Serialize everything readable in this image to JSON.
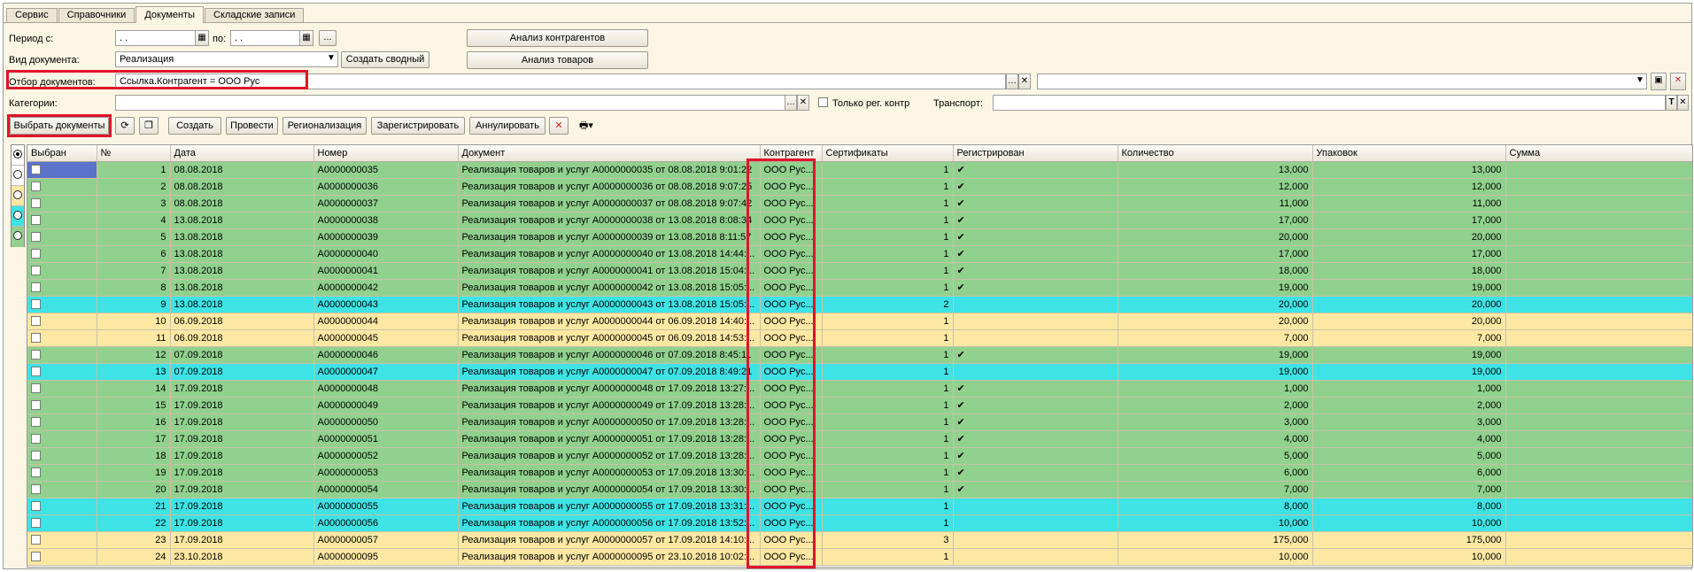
{
  "tabs": [
    "Сервис",
    "Справочники",
    "Документы",
    "Складские записи"
  ],
  "active_tab": 2,
  "filters": {
    "period_label": "Период с:",
    "period_from": " .  . ",
    "period_to_label": "по:",
    "period_to": " .  . ",
    "more_button": "...",
    "doctype_label": "Вид документа:",
    "doctype_value": "Реализация",
    "create_summary": "Создать сводный",
    "analysis_contractors": "Анализ контрагентов",
    "analysis_goods": "Анализ товаров",
    "selection_label": "Отбор документов:",
    "selection_value": "Ссылка.Контрагент =  ООО Рус",
    "categories_label": "Категории:",
    "categories_value": "",
    "only_reg_label": "Только рег. контр",
    "transport_label": "Транспорт:",
    "transport_value": ""
  },
  "toolbar": {
    "select_docs": "Выбрать документы",
    "create": "Создать",
    "post": "Провести",
    "regionalize": "Регионализация",
    "register": "Зарегистрировать",
    "annul": "Аннулировать"
  },
  "columns": [
    "Выбран",
    "№",
    "Дата",
    "Номер",
    "Документ",
    "Контрагент",
    "Сертификаты",
    "Регистрирован",
    "Количество",
    "Упаковок",
    "Сумма"
  ],
  "rows": [
    {
      "n": "1",
      "date": "08.08.2018",
      "num": "А0000000035",
      "doc": "Реализация товаров и услуг А0000000035 от 08.08.2018 9:01:22",
      "ctr": "ООО Рус...",
      "cert": "1",
      "reg": "✔",
      "qty": "13,000",
      "pack": "13,000",
      "sum": "",
      "color": "green"
    },
    {
      "n": "2",
      "date": "08.08.2018",
      "num": "А0000000036",
      "doc": "Реализация товаров и услуг А0000000036 от 08.08.2018 9:07:25",
      "ctr": "ООО Рус...",
      "cert": "1",
      "reg": "✔",
      "qty": "12,000",
      "pack": "12,000",
      "sum": "",
      "color": "green"
    },
    {
      "n": "3",
      "date": "08.08.2018",
      "num": "А0000000037",
      "doc": "Реализация товаров и услуг А0000000037 от 08.08.2018 9:07:42",
      "ctr": "ООО Рус...",
      "cert": "1",
      "reg": "✔",
      "qty": "11,000",
      "pack": "11,000",
      "sum": "",
      "color": "green"
    },
    {
      "n": "4",
      "date": "13.08.2018",
      "num": "А0000000038",
      "doc": "Реализация товаров и услуг А0000000038 от 13.08.2018 8:08:34",
      "ctr": "ООО Рус...",
      "cert": "1",
      "reg": "✔",
      "qty": "17,000",
      "pack": "17,000",
      "sum": "",
      "color": "green"
    },
    {
      "n": "5",
      "date": "13.08.2018",
      "num": "А0000000039",
      "doc": "Реализация товаров и услуг А0000000039 от 13.08.2018 8:11:57",
      "ctr": "ООО Рус...",
      "cert": "1",
      "reg": "✔",
      "qty": "20,000",
      "pack": "20,000",
      "sum": "",
      "color": "green"
    },
    {
      "n": "6",
      "date": "13.08.2018",
      "num": "А0000000040",
      "doc": "Реализация товаров и услуг А0000000040 от 13.08.2018 14:44:...",
      "ctr": "ООО Рус...",
      "cert": "1",
      "reg": "✔",
      "qty": "17,000",
      "pack": "17,000",
      "sum": "",
      "color": "green"
    },
    {
      "n": "7",
      "date": "13.08.2018",
      "num": "А0000000041",
      "doc": "Реализация товаров и услуг А0000000041 от 13.08.2018 15:04:...",
      "ctr": "ООО Рус...",
      "cert": "1",
      "reg": "✔",
      "qty": "18,000",
      "pack": "18,000",
      "sum": "",
      "color": "green"
    },
    {
      "n": "8",
      "date": "13.08.2018",
      "num": "А0000000042",
      "doc": "Реализация товаров и услуг А0000000042 от 13.08.2018 15:05:...",
      "ctr": "ООО Рус...",
      "cert": "1",
      "reg": "✔",
      "qty": "19,000",
      "pack": "19,000",
      "sum": "",
      "color": "green"
    },
    {
      "n": "9",
      "date": "13.08.2018",
      "num": "А0000000043",
      "doc": "Реализация товаров и услуг А0000000043 от 13.08.2018 15:05:...",
      "ctr": "ООО Рус...",
      "cert": "2",
      "reg": "",
      "qty": "20,000",
      "pack": "20,000",
      "sum": "",
      "color": "cyan"
    },
    {
      "n": "10",
      "date": "06.09.2018",
      "num": "А0000000044",
      "doc": "Реализация товаров и услуг А0000000044 от 06.09.2018 14:40:...",
      "ctr": "ООО Рус...",
      "cert": "1",
      "reg": "",
      "qty": "20,000",
      "pack": "20,000",
      "sum": "",
      "color": "yellow"
    },
    {
      "n": "11",
      "date": "06.09.2018",
      "num": "А0000000045",
      "doc": "Реализация товаров и услуг А0000000045 от 06.09.2018 14:53:...",
      "ctr": "ООО Рус...",
      "cert": "1",
      "reg": "",
      "qty": "7,000",
      "pack": "7,000",
      "sum": "",
      "color": "yellow"
    },
    {
      "n": "12",
      "date": "07.09.2018",
      "num": "А0000000046",
      "doc": "Реализация товаров и услуг А0000000046 от 07.09.2018 8:45:11",
      "ctr": "ООО Рус...",
      "cert": "1",
      "reg": "✔",
      "qty": "19,000",
      "pack": "19,000",
      "sum": "",
      "color": "green"
    },
    {
      "n": "13",
      "date": "07.09.2018",
      "num": "А0000000047",
      "doc": "Реализация товаров и услуг А0000000047 от 07.09.2018 8:49:21",
      "ctr": "ООО Рус...",
      "cert": "1",
      "reg": "",
      "qty": "19,000",
      "pack": "19,000",
      "sum": "",
      "color": "cyan"
    },
    {
      "n": "14",
      "date": "17.09.2018",
      "num": "А0000000048",
      "doc": "Реализация товаров и услуг А0000000048 от 17.09.2018 13:27:...",
      "ctr": "ООО Рус...",
      "cert": "1",
      "reg": "✔",
      "qty": "1,000",
      "pack": "1,000",
      "sum": "",
      "color": "green"
    },
    {
      "n": "15",
      "date": "17.09.2018",
      "num": "А0000000049",
      "doc": "Реализация товаров и услуг А0000000049 от 17.09.2018 13:28:...",
      "ctr": "ООО Рус...",
      "cert": "1",
      "reg": "✔",
      "qty": "2,000",
      "pack": "2,000",
      "sum": "",
      "color": "green"
    },
    {
      "n": "16",
      "date": "17.09.2018",
      "num": "А0000000050",
      "doc": "Реализация товаров и услуг А0000000050 от 17.09.2018 13:28:...",
      "ctr": "ООО Рус...",
      "cert": "1",
      "reg": "✔",
      "qty": "3,000",
      "pack": "3,000",
      "sum": "",
      "color": "green"
    },
    {
      "n": "17",
      "date": "17.09.2018",
      "num": "А0000000051",
      "doc": "Реализация товаров и услуг А0000000051 от 17.09.2018 13:28:...",
      "ctr": "ООО Рус...",
      "cert": "1",
      "reg": "✔",
      "qty": "4,000",
      "pack": "4,000",
      "sum": "",
      "color": "green"
    },
    {
      "n": "18",
      "date": "17.09.2018",
      "num": "А0000000052",
      "doc": "Реализация товаров и услуг А0000000052 от 17.09.2018 13:28:...",
      "ctr": "ООО Рус...",
      "cert": "1",
      "reg": "✔",
      "qty": "5,000",
      "pack": "5,000",
      "sum": "",
      "color": "green"
    },
    {
      "n": "19",
      "date": "17.09.2018",
      "num": "А0000000053",
      "doc": "Реализация товаров и услуг А0000000053 от 17.09.2018 13:30:...",
      "ctr": "ООО Рус...",
      "cert": "1",
      "reg": "✔",
      "qty": "6,000",
      "pack": "6,000",
      "sum": "",
      "color": "green"
    },
    {
      "n": "20",
      "date": "17.09.2018",
      "num": "А0000000054",
      "doc": "Реализация товаров и услуг А0000000054 от 17.09.2018 13:30:...",
      "ctr": "ООО Рус...",
      "cert": "1",
      "reg": "✔",
      "qty": "7,000",
      "pack": "7,000",
      "sum": "",
      "color": "green"
    },
    {
      "n": "21",
      "date": "17.09.2018",
      "num": "А0000000055",
      "doc": "Реализация товаров и услуг А0000000055 от 17.09.2018 13:31:...",
      "ctr": "ООО Рус...",
      "cert": "1",
      "reg": "",
      "qty": "8,000",
      "pack": "8,000",
      "sum": "",
      "color": "cyan"
    },
    {
      "n": "22",
      "date": "17.09.2018",
      "num": "А0000000056",
      "doc": "Реализация товаров и услуг А0000000056 от 17.09.2018 13:52:...",
      "ctr": "ООО Рус...",
      "cert": "1",
      "reg": "",
      "qty": "10,000",
      "pack": "10,000",
      "sum": "",
      "color": "cyan"
    },
    {
      "n": "23",
      "date": "17.09.2018",
      "num": "А0000000057",
      "doc": "Реализация товаров и услуг А0000000057 от 17.09.2018 14:10:...",
      "ctr": "ООО Рус...",
      "cert": "3",
      "reg": "",
      "qty": "175,000",
      "pack": "175,000",
      "sum": "",
      "color": "yellow"
    },
    {
      "n": "24",
      "date": "23.10.2018",
      "num": "А0000000095",
      "doc": "Реализация товаров и услуг А0000000095 от 23.10.2018 10:02:...",
      "ctr": "ООО Рус...",
      "cert": "1",
      "reg": "",
      "qty": "10,000",
      "pack": "10,000",
      "sum": "",
      "color": "yellow"
    }
  ],
  "legend_colors": [
    "#ffffff",
    "#fde8a3",
    "#3ee3e5",
    "#91d18e"
  ],
  "colors": {
    "green": "#91d18e",
    "cyan": "#3ee3e5",
    "yellow": "#fde8a3",
    "highlight": "#e0142b"
  }
}
